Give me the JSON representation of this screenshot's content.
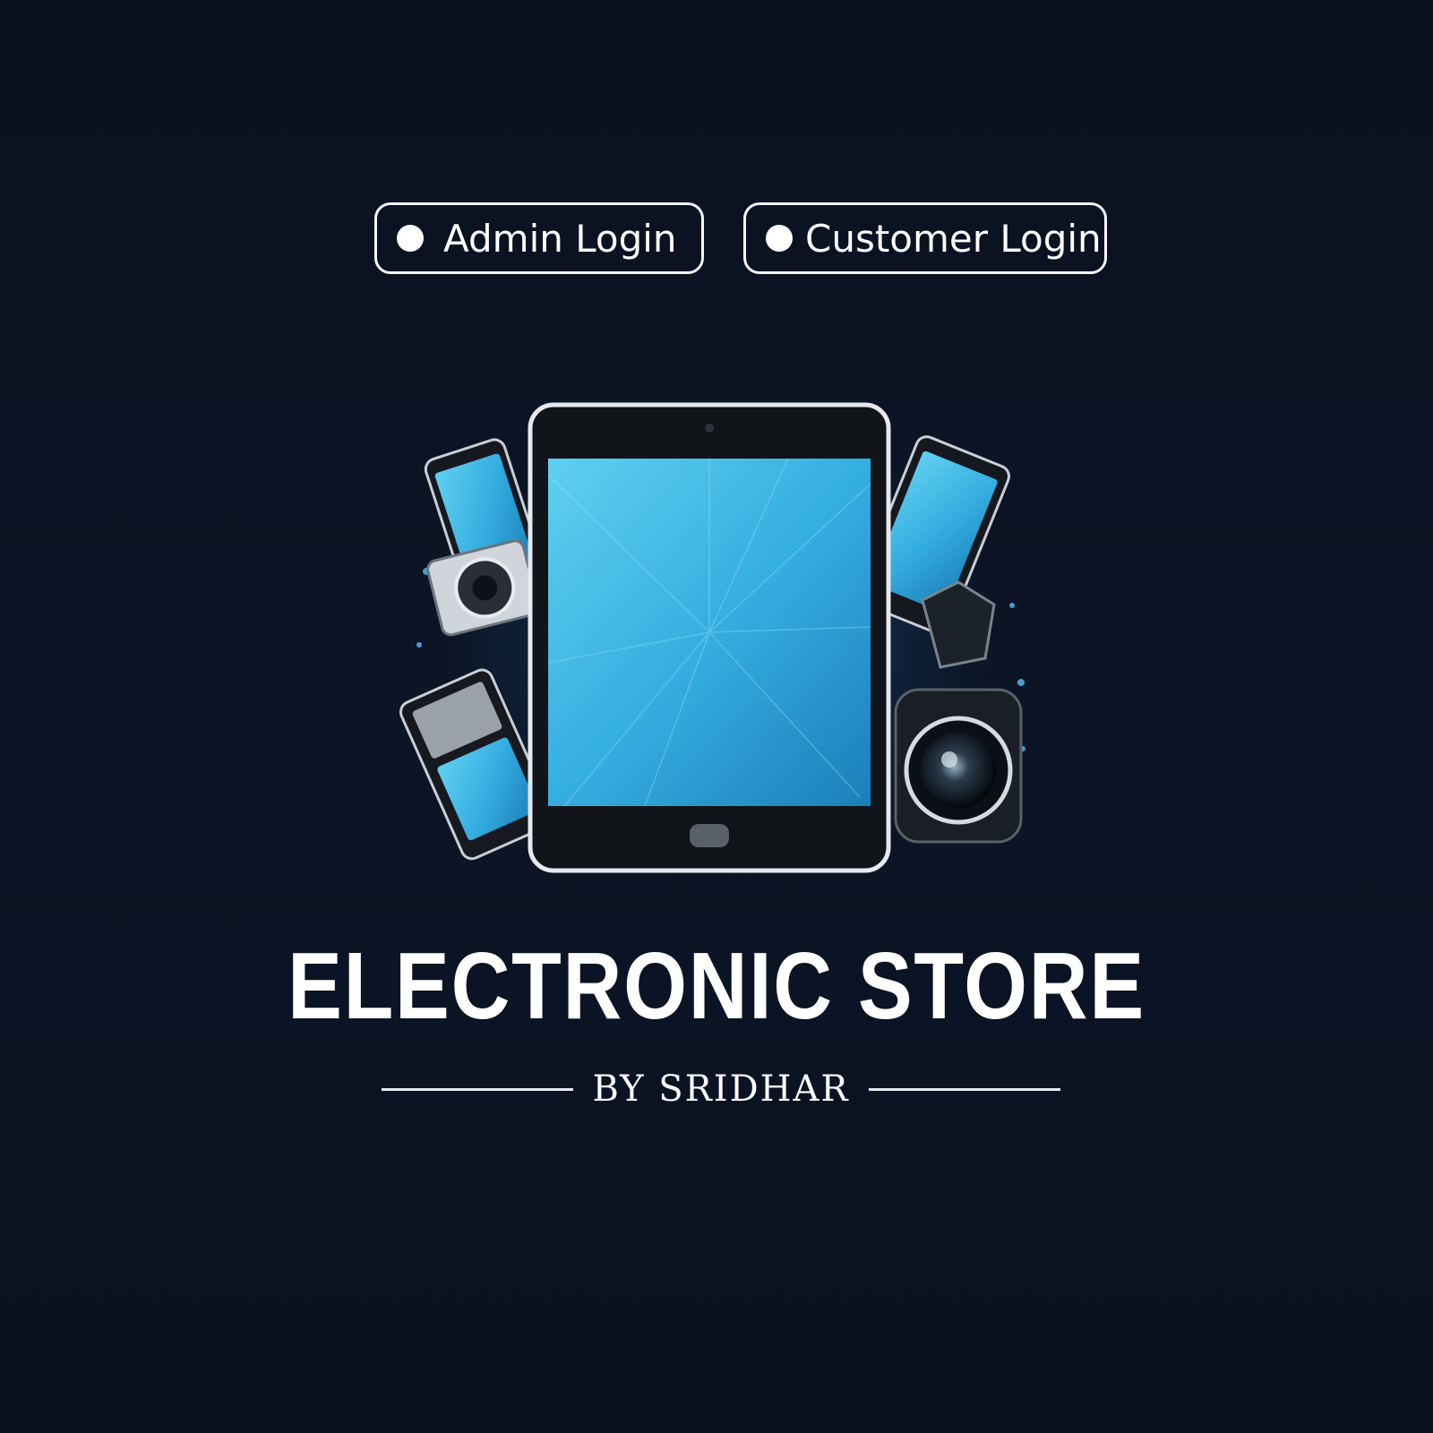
{
  "nav": {
    "admin_login_label": "Admin Login",
    "customer_login_label": "Customer Login"
  },
  "brand": {
    "title": "ELECTRONIC STORE",
    "byline": "BY SRIDHAR",
    "logo_icon": "electronics-devices-icon"
  },
  "colors": {
    "background": "#0b1322",
    "accent": "#35b6e3",
    "text": "#ffffff"
  }
}
